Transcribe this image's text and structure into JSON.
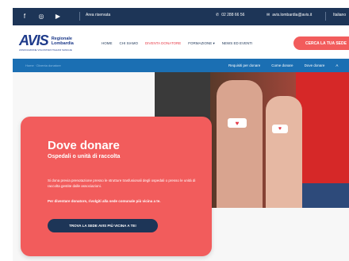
{
  "topbar": {
    "icons": [
      "facebook-icon",
      "instagram-icon",
      "youtube-icon"
    ],
    "area_label": "Area riservata",
    "phone": "02 288 66 56",
    "email": "avis.lombardia@avis.it",
    "language": "Italiano"
  },
  "header": {
    "logo_text": "AVIS",
    "region_line1": "Regionale",
    "region_line2": "Lombardia",
    "tagline": "ASSOCIAZIONE VOLONTARI ITALIANI SANGUE",
    "nav": [
      {
        "label": "HOME"
      },
      {
        "label": "CHI SIAMO"
      },
      {
        "label": "DIVENTA DONATORE",
        "active": true
      },
      {
        "label": "FORMAZIONE ▾"
      },
      {
        "label": "NEWS ED EVENTI"
      }
    ],
    "cta_label": "CERCA LA TUA SEDE"
  },
  "subnav": {
    "breadcrumb": "Home · Diventa donatore",
    "links": [
      "Requisiti per donare",
      "Come donare",
      "Dove donare",
      "A"
    ]
  },
  "hero": {
    "title": "Dove donare",
    "subtitle": "Ospedali o unità di raccolta",
    "description": "Si dona previa prenotazione presso le strutture trasfusionali degli ospedali o presso le unità di raccolta gestite dalle associazioni.",
    "bold_text": "Per diventare donatore, rivolgiti alla sede comunale più vicina a te.",
    "button_label": "TROVA LA SEDE AVIS PIÙ VICINA A TE!"
  },
  "colors": {
    "topbar": "#1d3557",
    "accent_red": "#f25c5c",
    "subnav_blue": "#1b6fb3"
  }
}
